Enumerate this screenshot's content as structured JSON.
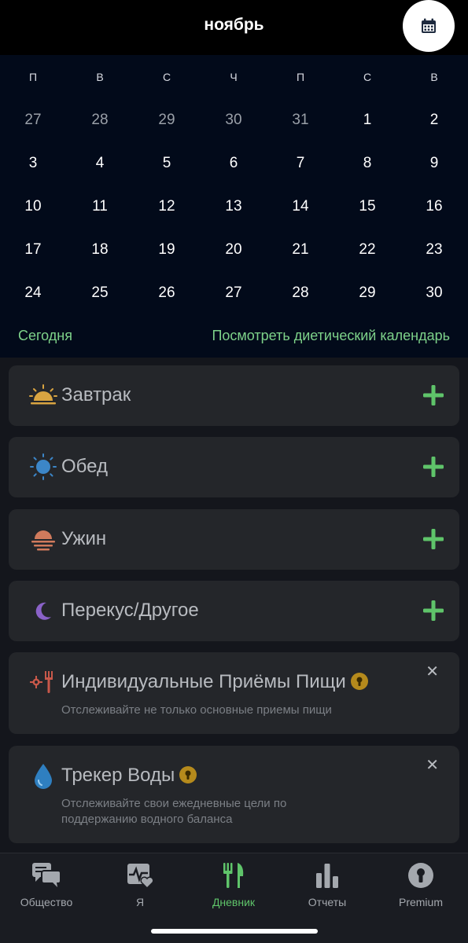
{
  "header": {
    "month": "ноябрь"
  },
  "calendar": {
    "weekdays": [
      "П",
      "В",
      "С",
      "Ч",
      "П",
      "С",
      "В"
    ],
    "weeks": [
      [
        "27",
        "28",
        "29",
        "30",
        "31",
        "1",
        "2"
      ],
      [
        "3",
        "4",
        "5",
        "6",
        "7",
        "8",
        "9"
      ],
      [
        "10",
        "11",
        "12",
        "13",
        "14",
        "15",
        "16"
      ],
      [
        "17",
        "18",
        "19",
        "20",
        "21",
        "22",
        "23"
      ],
      [
        "24",
        "25",
        "26",
        "27",
        "28",
        "29",
        "30"
      ]
    ],
    "today_link": "Сегодня",
    "diet_calendar_link": "Посмотреть диетический календарь"
  },
  "meals": {
    "breakfast": "Завтрак",
    "lunch": "Обед",
    "dinner": "Ужин",
    "snack": "Перекус/Другое"
  },
  "promos": {
    "custom_meals": {
      "title": "Индивидуальные Приёмы Пищи",
      "subtitle": "Отслеживайте не только основные приемы пищи"
    },
    "water": {
      "title": "Трекер Воды",
      "subtitle": "Отслеживайте свои ежедневные цели по поддержанию водного баланса"
    }
  },
  "nav": {
    "community": "Общество",
    "me": "Я",
    "diary": "Дневник",
    "reports": "Отчеты",
    "premium": "Premium"
  },
  "colors": {
    "accent": "#5fc46a",
    "link": "#7ed28a",
    "card": "#24262a",
    "calendar_bg": "#020a1a",
    "lock": "#b58a1c"
  }
}
